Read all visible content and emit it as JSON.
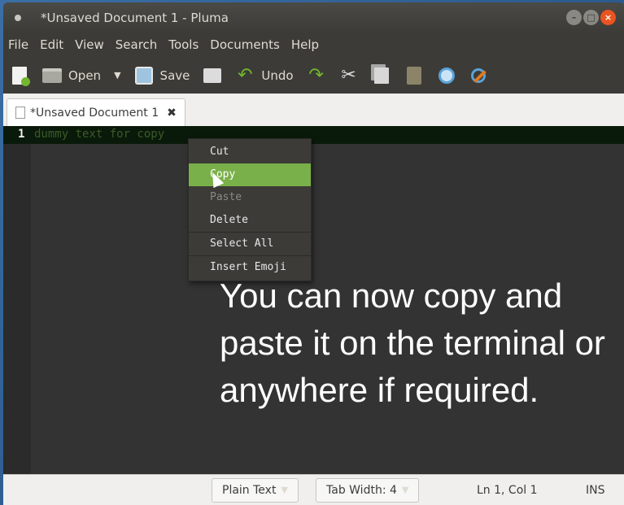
{
  "titlebar": {
    "title": "*Unsaved Document 1 - Pluma"
  },
  "menu": [
    "File",
    "Edit",
    "View",
    "Search",
    "Tools",
    "Documents",
    "Help"
  ],
  "toolbar": {
    "open_label": "Open",
    "save_label": "Save",
    "undo_label": "Undo"
  },
  "tab": {
    "label": "*Unsaved Document 1"
  },
  "editor": {
    "line_number": "1",
    "line_text": "dummy text for copy"
  },
  "context_menu": {
    "items": [
      "Cut",
      "Copy",
      "Paste",
      "Delete",
      "Select All",
      "Insert Emoji"
    ],
    "highlighted": "Copy",
    "disabled": [
      "Paste"
    ]
  },
  "caption": "You can now copy and paste it on the terminal or anywhere if required.",
  "statusbar": {
    "language": "Plain Text",
    "tab_width": "Tab Width: 4",
    "position": "Ln 1, Col 1",
    "mode": "INS"
  },
  "colors": {
    "accent": "#7ab04a",
    "close_button": "#e95420"
  }
}
